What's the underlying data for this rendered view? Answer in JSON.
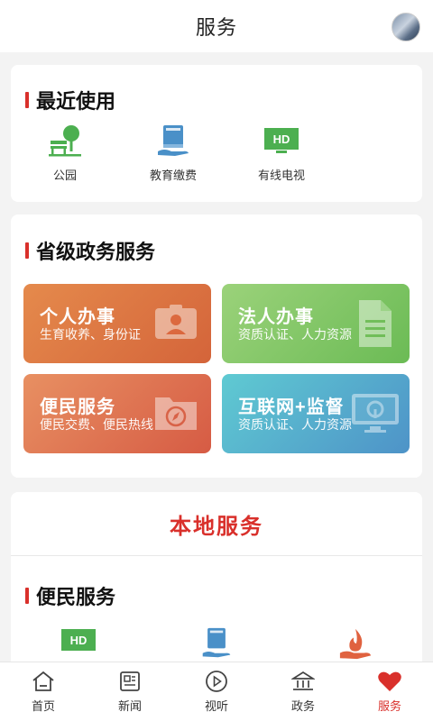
{
  "header": {
    "title": "服务"
  },
  "recent": {
    "title": "最近使用",
    "items": [
      {
        "label": "公园",
        "icon": "park-icon"
      },
      {
        "label": "教育缴费",
        "icon": "book-hand-icon"
      },
      {
        "label": "有线电视",
        "icon": "hd-tv-icon",
        "badge": "HD"
      }
    ]
  },
  "provincial": {
    "title": "省级政务服务",
    "tiles": [
      {
        "title": "个人办事",
        "subtitle": "生育收养、身份证",
        "icon": "id-card-icon"
      },
      {
        "title": "法人办事",
        "subtitle": "资质认证、人力资源",
        "icon": "document-icon"
      },
      {
        "title": "便民服务",
        "subtitle": "便民交费、便民热线",
        "icon": "folder-compass-icon"
      },
      {
        "title": "互联网+监督",
        "subtitle": "资质认证、人力资源",
        "icon": "monitor-icon"
      }
    ]
  },
  "local": {
    "title": "本地服务",
    "section_title": "便民服务",
    "items": [
      {
        "icon": "hd-tv-icon",
        "badge": "HD"
      },
      {
        "icon": "book-hand-icon"
      },
      {
        "icon": "flame-hand-icon"
      }
    ]
  },
  "tabbar": {
    "tabs": [
      {
        "label": "首页",
        "icon": "home-icon"
      },
      {
        "label": "新闻",
        "icon": "news-icon"
      },
      {
        "label": "视听",
        "icon": "play-icon"
      },
      {
        "label": "政务",
        "icon": "government-icon"
      },
      {
        "label": "服务",
        "icon": "heart-icon",
        "active": true
      }
    ]
  },
  "colors": {
    "accent": "#d9302b",
    "green": "#4caf50",
    "blue": "#4a90c8",
    "orange": "#e0623f"
  }
}
